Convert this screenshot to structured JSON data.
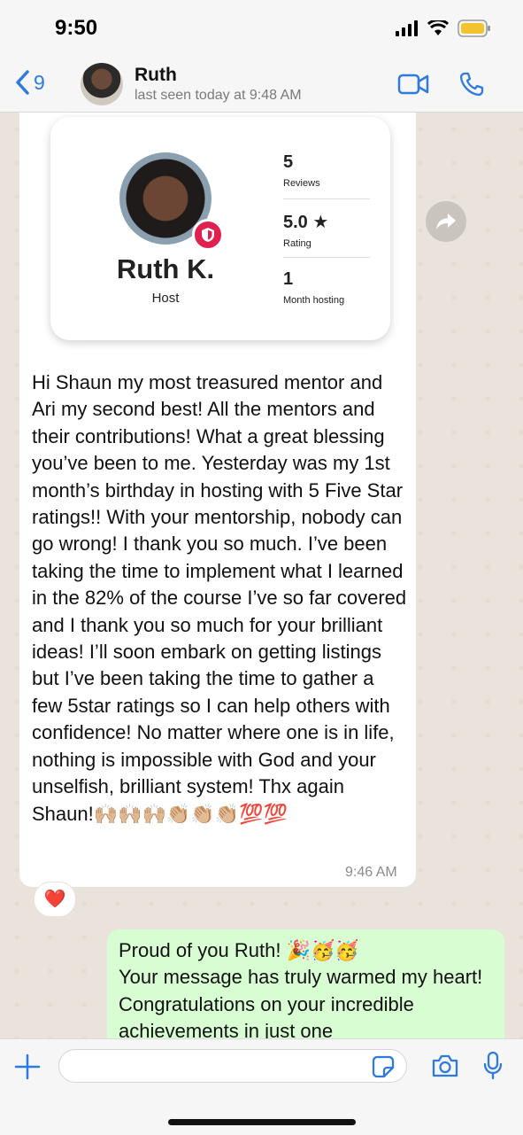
{
  "status_bar": {
    "time": "9:50"
  },
  "header": {
    "back_count": "9",
    "contact_name": "Ruth",
    "contact_status": "last seen today at 9:48 AM"
  },
  "profile_card": {
    "name": "Ruth K.",
    "role": "Host",
    "stats": [
      {
        "value": "5",
        "label": "Reviews"
      },
      {
        "value": "5.0 ★",
        "label": "Rating"
      },
      {
        "value": "1",
        "label": "Month hosting"
      }
    ]
  },
  "incoming_message": {
    "text": "Hi Shaun my most treasured mentor and Ari my second best! All the mentors and their contributions! What a great blessing you’ve been to me. Yesterday was my 1st month’s birthday in hosting with 5 Five Star ratings!! With your mentorship, nobody can go wrong! I thank you so much. I’ve been taking the time to implement what I learned in the 82% of the course I’ve so far covered and I thank you so much for your brilliant ideas! I’ll soon embark on getting listings but I’ve been taking the time to gather a few 5star ratings so I can help others with confidence! No matter where one is in life, nothing is impossible with God and your unselfish, brilliant system! Thx again Shaun!🙌🏼🙌🏼🙌🏼👏🏼👏🏼👏🏼💯💯",
    "time": "9:46 AM",
    "reaction": "❤️"
  },
  "outgoing_message": {
    "text": "Proud of you Ruth! 🎉🥳🥳\nYour message has truly warmed my heart! Congratulations on your incredible achievements in just one"
  },
  "colors": {
    "accent": "#2f7ae0",
    "outgoing_bubble": "#d9fdd3",
    "verified_badge": "#e0204f"
  }
}
